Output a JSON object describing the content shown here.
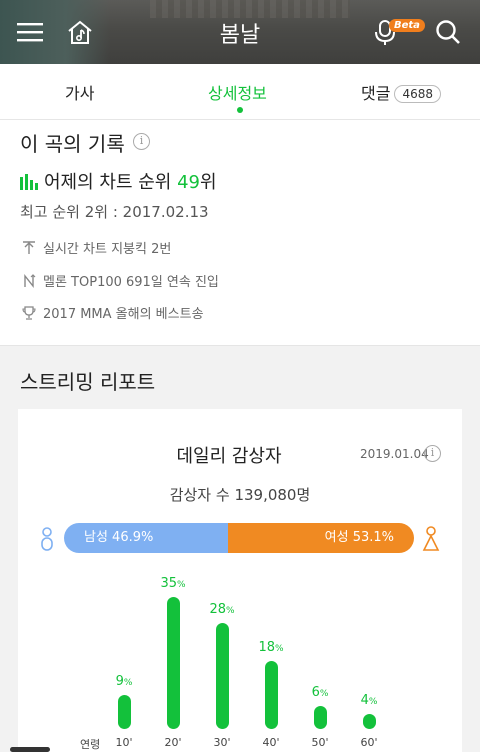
{
  "header": {
    "title": "봄날",
    "beta": "Beta"
  },
  "tabs": {
    "lyrics": "가사",
    "details": "상세정보",
    "comments": "댓글",
    "comment_count": "4688"
  },
  "record": {
    "title": "이 곡의 기록",
    "rank_prefix": "어제의 차트 순위 ",
    "rank_num": "49",
    "rank_suffix": "위",
    "best": "최고 순위 2위 : 2017.02.13",
    "achievements": [
      {
        "icon": "rise-icon",
        "text": "실시간 차트 지붕킥 2번"
      },
      {
        "icon": "streak-icon",
        "text": "멜론 TOP100 691일 연속 진입"
      },
      {
        "icon": "trophy-icon",
        "text": "2017 MMA 올해의 베스트송"
      }
    ]
  },
  "report": {
    "title": "스트리밍 리포트",
    "card_title": "데일리 감상자",
    "date": "2019.01.04",
    "listeners": "감상자 수 139,080명",
    "male_label": "남성 46.9%",
    "female_label": "여성 53.1%",
    "male_pct": 46.9,
    "female_pct": 53.1,
    "age_axis_label": "연령",
    "ages": [
      {
        "label": "10'",
        "value": 9
      },
      {
        "label": "20'",
        "value": 35
      },
      {
        "label": "30'",
        "value": 28
      },
      {
        "label": "40'",
        "value": 18
      },
      {
        "label": "50'",
        "value": 6
      },
      {
        "label": "60'",
        "value": 4
      }
    ]
  },
  "colors": {
    "accent": "#13c13b",
    "male": "#7fb0f2",
    "female": "#f08a22"
  }
}
